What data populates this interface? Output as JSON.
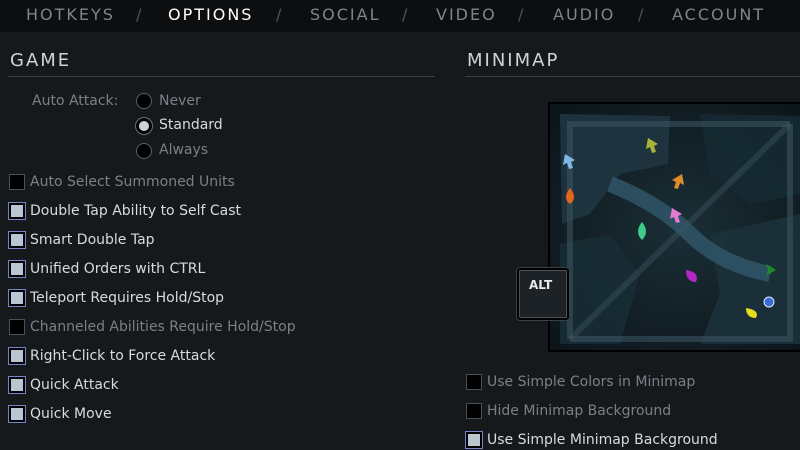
{
  "tabs": [
    {
      "label": "HOTKEYS",
      "active": false
    },
    {
      "label": "OPTIONS",
      "active": true
    },
    {
      "label": "SOCIAL",
      "active": false
    },
    {
      "label": "VIDEO",
      "active": false
    },
    {
      "label": "AUDIO",
      "active": false
    },
    {
      "label": "ACCOUNT",
      "active": false
    }
  ],
  "tab_separator": "/",
  "game": {
    "title": "GAME",
    "auto_attack": {
      "label": "Auto Attack:",
      "options": [
        "Never",
        "Standard",
        "Always"
      ],
      "selected": "Standard"
    },
    "checkboxes": [
      {
        "label": "Auto Select Summoned Units",
        "checked": false,
        "enabled": false
      },
      {
        "label": "Double Tap Ability to Self Cast",
        "checked": true,
        "enabled": true
      },
      {
        "label": "Smart Double Tap",
        "checked": true,
        "enabled": true
      },
      {
        "label": "Unified Orders with CTRL",
        "checked": true,
        "enabled": true
      },
      {
        "label": "Teleport Requires Hold/Stop",
        "checked": true,
        "enabled": true
      },
      {
        "label": "Channeled Abilities Require Hold/Stop",
        "checked": false,
        "enabled": false
      },
      {
        "label": "Right-Click to Force Attack",
        "checked": true,
        "enabled": true
      },
      {
        "label": "Quick Attack",
        "checked": true,
        "enabled": true
      },
      {
        "label": "Quick Move",
        "checked": true,
        "enabled": true
      }
    ]
  },
  "minimap": {
    "title": "MINIMAP",
    "alt_key_label": "ALT",
    "checkboxes": [
      {
        "label": "Use Simple Colors in Minimap",
        "checked": false,
        "enabled": false
      },
      {
        "label": "Hide Minimap Background",
        "checked": false,
        "enabled": false
      },
      {
        "label": "Use Simple Minimap Background",
        "checked": true,
        "enabled": true
      }
    ],
    "markers": [
      {
        "name": "light-blue-arrow-icon",
        "color": "#7fb8e6"
      },
      {
        "name": "olive-arrow-icon",
        "color": "#a9b33a"
      },
      {
        "name": "orange-drop-icon",
        "color": "#e4651c"
      },
      {
        "name": "orange-arrow-icon",
        "color": "#e08a2a"
      },
      {
        "name": "pink-arrow-icon",
        "color": "#e47ad0"
      },
      {
        "name": "green-drop-icon",
        "color": "#3fca8a"
      },
      {
        "name": "magenta-drop-icon",
        "color": "#b528c8"
      },
      {
        "name": "dark-green-arrow-icon",
        "color": "#1e8a2c"
      },
      {
        "name": "blue-circle-icon",
        "color": "#3d6bd6"
      },
      {
        "name": "yellow-drop-icon",
        "color": "#e6dc1e"
      }
    ]
  }
}
